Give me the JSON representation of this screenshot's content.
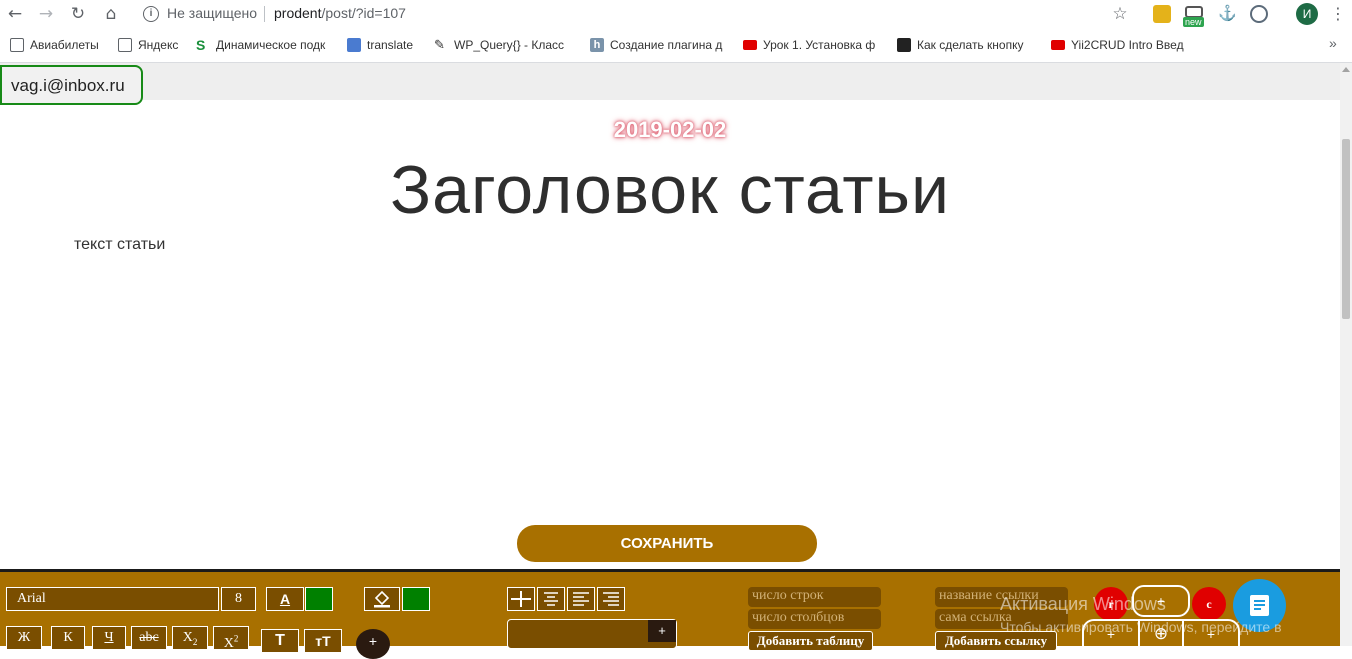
{
  "browser": {
    "security_label": "Не защищено",
    "url_host": "prodent",
    "url_path": "/post/?id=107",
    "profile_initial": "И",
    "ext_new_badge": "new"
  },
  "bookmarks": [
    {
      "label": "Авиабилеты",
      "icon": "page-icon",
      "color": "#5f6368"
    },
    {
      "label": "Яндекс",
      "icon": "page-icon",
      "color": "#5f6368"
    },
    {
      "label": "Динамическое подк",
      "icon": "s-logo-icon",
      "color": "#1a8f3b"
    },
    {
      "label": "translate",
      "icon": "translate-icon",
      "color": "#4a7bd0"
    },
    {
      "label": "WP_Query{} - Класс",
      "icon": "wp-icon",
      "color": "#333333"
    },
    {
      "label": "Создание плагина д",
      "icon": "h-icon",
      "color": "#7a93aa"
    },
    {
      "label": "Урок 1. Установка ф",
      "icon": "youtube-icon",
      "color": "#e00000"
    },
    {
      "label": "Как сделать кнопку",
      "icon": "htmlbook-icon",
      "color": "#222222"
    },
    {
      "label": "Yii2CRUD Intro Введ",
      "icon": "youtube-icon",
      "color": "#e00000"
    }
  ],
  "page": {
    "user_email": "vag.i@inbox.ru",
    "date": "2019-02-02",
    "title": "Заголовок статьи",
    "body": "текст статьи",
    "save_label": "СОХРАНИТЬ"
  },
  "toolbar": {
    "font_family": "Arial",
    "font_size": "8",
    "text_color_label": "A",
    "swatch_color": "#008000",
    "format_buttons": [
      "Ж",
      "К",
      "Ч",
      "abc",
      "X2",
      "X2"
    ],
    "t_label": "T",
    "tt_label": "тT",
    "plus_label": "+",
    "rows_placeholder": "число строк",
    "cols_placeholder": "число столбцов",
    "add_table_label": "Добавить таблицу",
    "link_name_placeholder": "название ссылки",
    "link_url_placeholder": "сама ссылка",
    "add_link_label": "Добавить ссылку",
    "red_label_1": "r",
    "red_label_2": "c",
    "ring_plus": "+",
    "ring_plus_circle": "⊕"
  },
  "watermark": {
    "line1": "Активация Windows",
    "line2": "Чтобы активировать Windows, перейдите в"
  }
}
